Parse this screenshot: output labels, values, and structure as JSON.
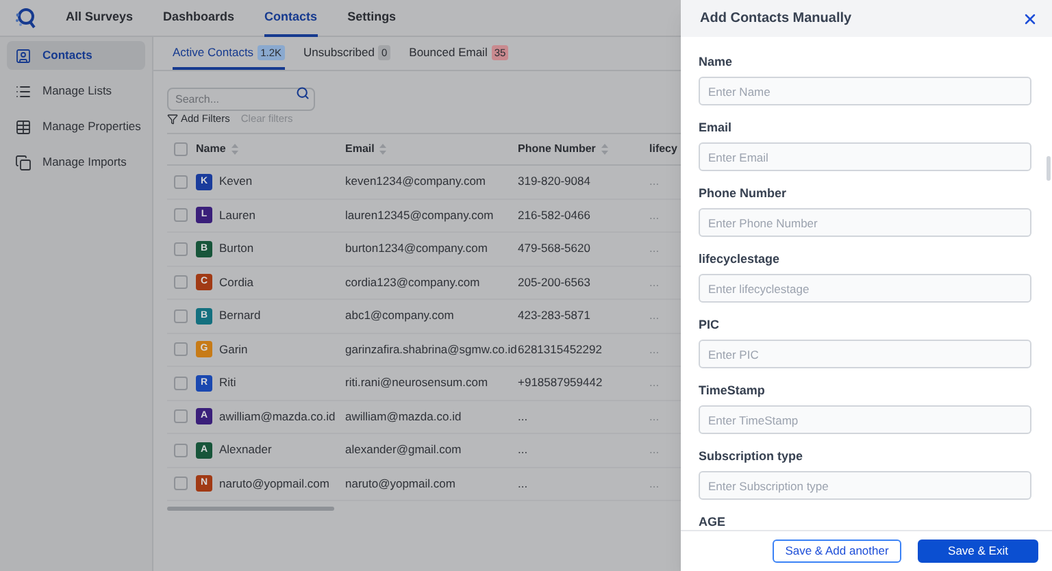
{
  "nav": [
    {
      "label": "All Surveys",
      "selected": false
    },
    {
      "label": "Dashboards",
      "selected": false
    },
    {
      "label": "Contacts",
      "selected": true
    },
    {
      "label": "Settings",
      "selected": false
    }
  ],
  "sidebar": {
    "items": [
      {
        "label": "Contacts",
        "selected": true
      },
      {
        "label": "Manage Lists",
        "selected": false
      },
      {
        "label": "Manage Properties",
        "selected": false
      },
      {
        "label": "Manage Imports",
        "selected": false
      }
    ]
  },
  "tabs": [
    {
      "label": "Active Contacts",
      "count": "1.2K",
      "color": "#8aa9cf",
      "selected": true
    },
    {
      "label": "Unsubscribed",
      "count": "0",
      "color": "#a3a5a8",
      "selected": false
    },
    {
      "label": "Bounced Email",
      "count": "35",
      "color": "#c98a8f",
      "selected": false
    }
  ],
  "search": {
    "placeholder": "Search..."
  },
  "filters": {
    "add": "Add Filters",
    "clear": "Clear filters"
  },
  "table": {
    "select_all": {
      "checked": false
    },
    "columns": [
      "Name",
      "Email",
      "Phone Number",
      "lifecy"
    ],
    "rows": [
      {
        "initial": "K",
        "color": "#1a3c9c",
        "name": "Keven",
        "email": "keven1234@company.com",
        "phone": "319-820-9084",
        "column_4": "...",
        "checked": false
      },
      {
        "initial": "L",
        "color": "#3a1f7a",
        "name": "Lauren",
        "email": "lauren12345@company.com",
        "phone": "216-582-0466",
        "column_4": "...",
        "checked": false
      },
      {
        "initial": "B",
        "color": "#17553a",
        "name": "Burton",
        "email": "burton1234@company.com",
        "phone": "479-568-5620",
        "column_4": "...",
        "checked": false
      },
      {
        "initial": "C",
        "color": "#a13a15",
        "name": "Cordia",
        "email": "cordia123@company.com",
        "phone": "205-200-6563",
        "column_4": "...",
        "checked": false
      },
      {
        "initial": "B",
        "color": "#14707f",
        "name": "Bernard",
        "email": "abc1@company.com",
        "phone": "423-283-5871",
        "column_4": "...",
        "checked": false
      },
      {
        "initial": "G",
        "color": "#c77b17",
        "name": "Garin",
        "email": "garinzafira.shabrina@sgmw.co.id",
        "phone": "6281315452292",
        "column_4": "...",
        "checked": false
      },
      {
        "initial": "R",
        "color": "#1a48b0",
        "name": "Riti",
        "email": "riti.rani@neurosensum.com",
        "phone": "+918587959442",
        "column_4": "...",
        "checked": false
      },
      {
        "initial": "A",
        "color": "#3a1f7a",
        "name": "awilliam@mazda.co.id",
        "email": "awilliam@mazda.co.id",
        "phone": "...",
        "column_4": "...",
        "checked": false
      },
      {
        "initial": "A",
        "color": "#17553a",
        "name": "Alexnader",
        "email": "alexander@gmail.com",
        "phone": "...",
        "column_4": "...",
        "checked": false
      },
      {
        "initial": "N",
        "color": "#a13a15",
        "name": "naruto@yopmail.com",
        "email": "naruto@yopmail.com",
        "phone": "...",
        "column_4": "...",
        "checked": false
      }
    ]
  },
  "drawer": {
    "title": "Add Contacts Manually",
    "fields": [
      {
        "label": "Name",
        "placeholder": "Enter Name"
      },
      {
        "label": "Email",
        "placeholder": "Enter Email"
      },
      {
        "label": "Phone Number",
        "placeholder": "Enter Phone Number"
      },
      {
        "label": "lifecyclestage",
        "placeholder": "Enter lifecyclestage"
      },
      {
        "label": "PIC",
        "placeholder": "Enter PIC"
      },
      {
        "label": "TimeStamp",
        "placeholder": "Enter TimeStamp"
      },
      {
        "label": "Subscription type",
        "placeholder": "Enter Subscription type"
      }
    ],
    "next_label": "AGE",
    "buttons": [
      {
        "label": "Save & Add another",
        "kind": "secondary"
      },
      {
        "label": "Save & Exit",
        "kind": "primary"
      }
    ]
  }
}
